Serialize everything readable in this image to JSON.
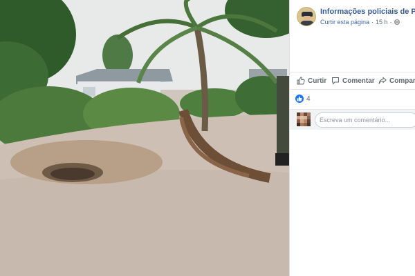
{
  "post": {
    "page_name": "Informações policiais de Pojuca",
    "like_page": "Curtir esta página",
    "separator": "·",
    "time": "15 h",
    "globe_icon": "globe-icon"
  },
  "actions": {
    "like": "Curtir",
    "comment": "Comentar",
    "share": "Compartilhar"
  },
  "reactions": {
    "count": "4",
    "icon": "like-reaction-icon"
  },
  "comment_box": {
    "placeholder": "Escreva um comentário..."
  },
  "colors": {
    "link": "#365899",
    "accent": "#4267b2",
    "like_badge": "#1877f2",
    "meta_text": "#606770"
  }
}
